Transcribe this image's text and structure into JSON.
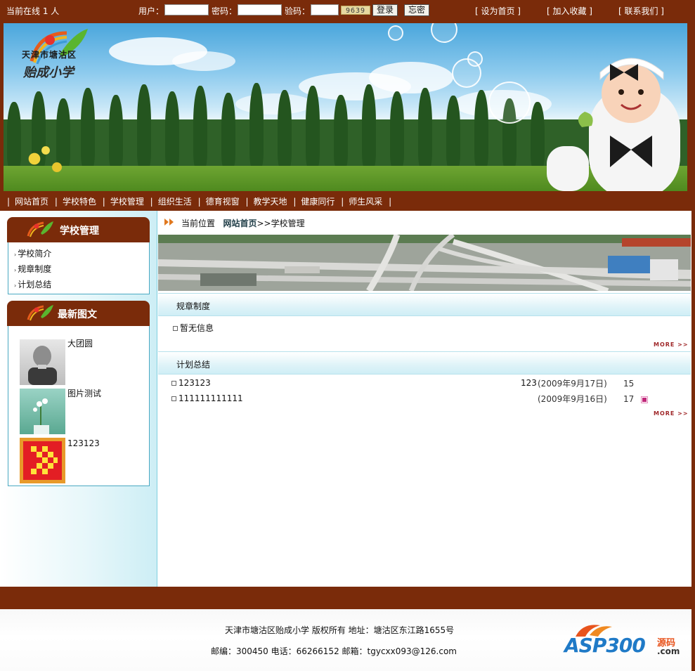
{
  "topbar": {
    "online_text": "当前在线  1 人",
    "user_label": "用户：",
    "password_label": "密码：",
    "captcha_label": "验码：",
    "captcha_code": "9639",
    "login_button": "登录",
    "forgot_button": "忘密",
    "links": [
      "[ 设为首页 ]",
      "[ 加入收藏 ]",
      "[ 联系我们 ]"
    ]
  },
  "banner": {
    "logo_line1": "天津市塘沽区",
    "logo_line2": "贻成小学"
  },
  "nav": {
    "items": [
      "网站首页",
      "学校特色",
      "学校管理",
      "组织生活",
      "德育视窗",
      "教学天地",
      "健康同行",
      "师生风采"
    ]
  },
  "sidebar": {
    "menu_title": "学校管理",
    "menu_items": [
      "学校简介",
      "规章制度",
      "计划总结"
    ],
    "news_title": "最新图文",
    "news_items": [
      "大团圆",
      "图片测试",
      "123123"
    ]
  },
  "breadcrumb": {
    "prefix": "当前位置",
    "home": "网站首页",
    "suffix": ">>学校管理"
  },
  "sections": [
    {
      "title": "规章制度",
      "empty_text": "暂无信息",
      "more": "MORE >>"
    },
    {
      "title": "计划总结",
      "more": "MORE >>",
      "rows": [
        {
          "title": "123123",
          "author": "123",
          "date": "(2009年9月17日)",
          "hits": "15"
        },
        {
          "title": "111111111111",
          "author": "",
          "date": "(2009年9月16日)",
          "hits": "17"
        }
      ]
    }
  ],
  "footer": {
    "line1": "天津市塘沽区贻成小学  版权所有      地址：塘沽区东江路1655号",
    "line2": "邮编：300450      电话：66266152      邮箱：tgycxx093@126.com",
    "brand_main": "ASP300",
    "brand_sub": "源码",
    "brand_domain": ".com"
  },
  "colors": {
    "brand_brown": "#7a2b0a",
    "cyan_border": "#4aa9c2",
    "more_red": "#a0282a"
  }
}
